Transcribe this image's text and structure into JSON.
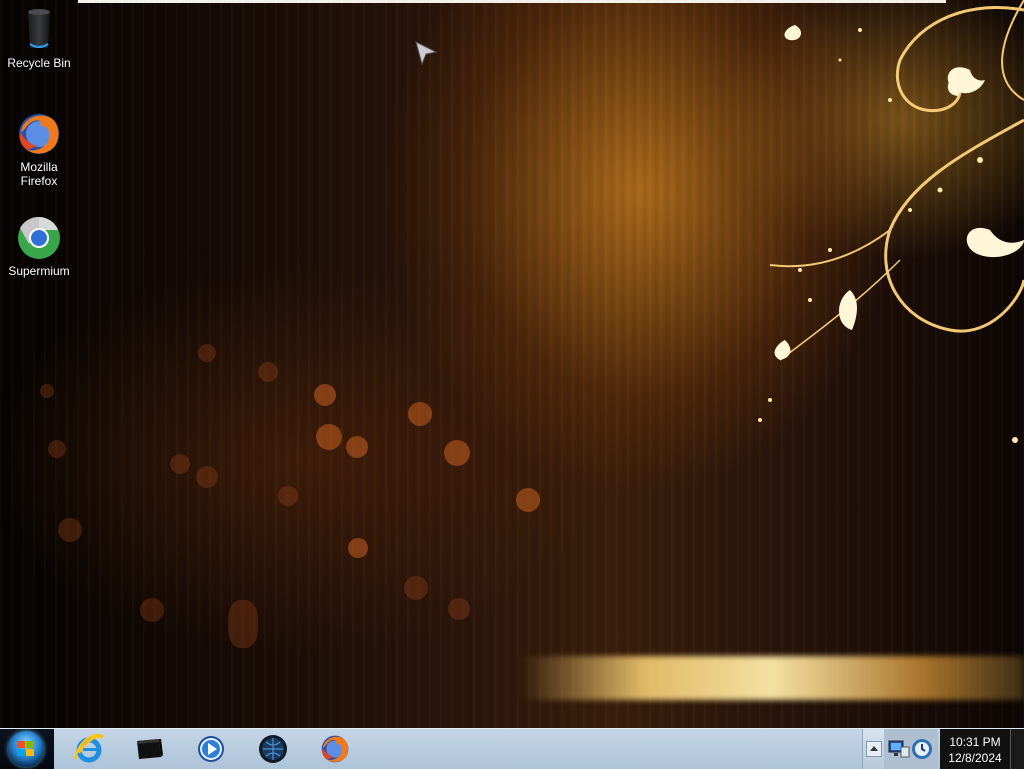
{
  "desktop": {
    "icons": [
      {
        "label": "Recycle Bin",
        "icon": "recycle-bin-icon"
      },
      {
        "label": "Mozilla Firefox",
        "icon": "firefox-icon"
      },
      {
        "label": "Supermium",
        "icon": "supermium-icon"
      }
    ]
  },
  "taskbar": {
    "start_icon": "windows-start-orb",
    "pinned": [
      {
        "icon": "internet-explorer-icon"
      },
      {
        "icon": "command-prompt-icon"
      },
      {
        "icon": "media-player-icon"
      },
      {
        "icon": "browser-globe-icon"
      },
      {
        "icon": "firefox-icon"
      }
    ],
    "tray": {
      "icons": [
        "network-icon",
        "updater-icon"
      ],
      "time": "10:31 PM",
      "date": "12/8/2024"
    }
  },
  "colors": {
    "taskbar": "#b8cbde",
    "clock_bg": "#111111"
  }
}
